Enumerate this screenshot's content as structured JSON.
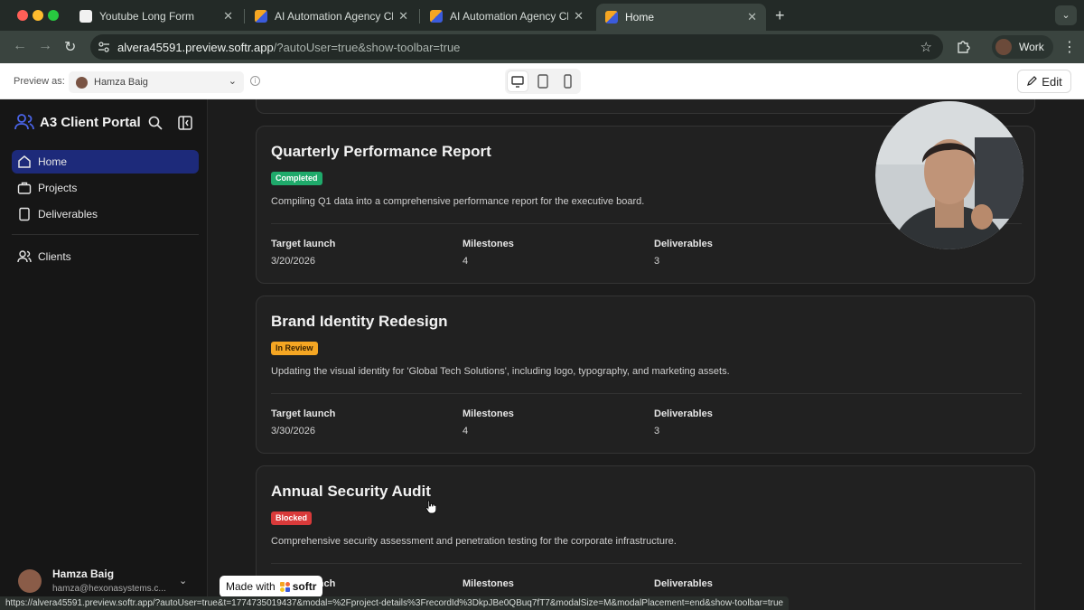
{
  "browser": {
    "tabs": [
      {
        "title": "Youtube Long Form",
        "active": false
      },
      {
        "title": "AI Automation Agency Client",
        "active": false
      },
      {
        "title": "AI Automation Agency Client",
        "active": false
      },
      {
        "title": "Home",
        "active": true
      }
    ],
    "url_host": "alvera45591.preview.softr.app",
    "url_path": "/?autoUser=true&show-toolbar=true",
    "profile_label": "Work",
    "status_url": "https://alvera45591.preview.softr.app/?autoUser=true&t=1774735019437&modal=%2Fproject-details%3FrecordId%3DkpJBe0QBuq7fT7&modalSize=M&modalPlacement=end&show-toolbar=true"
  },
  "toolbar": {
    "preview_label": "Preview as:",
    "preview_user": "Hamza Baig",
    "edit_label": "Edit"
  },
  "sidebar": {
    "app_name": "A3 Client Portal",
    "items": [
      {
        "label": "Home",
        "icon": "home-icon",
        "active": true
      },
      {
        "label": "Projects",
        "icon": "briefcase-icon",
        "active": false
      },
      {
        "label": "Deliverables",
        "icon": "document-icon",
        "active": false
      },
      {
        "label": "Clients",
        "icon": "users-icon",
        "active": false
      }
    ],
    "user": {
      "name": "Hamza Baig",
      "email": "hamza@hexonasystems.c..."
    }
  },
  "projects": [
    {
      "title": "Quarterly Performance Report",
      "status": "Completed",
      "description": "Compiling Q1 data into a comprehensive performance report for the executive board.",
      "target_launch_label": "Target launch",
      "target_launch": "3/20/2026",
      "milestones_label": "Milestones",
      "milestones": "4",
      "deliverables_label": "Deliverables",
      "deliverables": "3"
    },
    {
      "title": "Brand Identity Redesign",
      "status": "In Review",
      "description": "Updating the visual identity for 'Global Tech Solutions', including logo, typography, and marketing assets.",
      "target_launch_label": "Target launch",
      "target_launch": "3/30/2026",
      "milestones_label": "Milestones",
      "milestones": "4",
      "deliverables_label": "Deliverables",
      "deliverables": "3"
    },
    {
      "title": "Annual Security Audit",
      "status": "Blocked",
      "description": "Comprehensive security assessment and penetration testing for the corporate infrastructure.",
      "target_launch_label": "Target launch",
      "milestones_label": "Milestones",
      "deliverables_label": "Deliverables"
    }
  ],
  "badge": {
    "made_with": "Made with",
    "brand": "softr"
  },
  "colors": {
    "accent": "#1d2a7a",
    "completed": "#1faa6b",
    "in_review": "#f5a623",
    "blocked": "#d93a3a"
  }
}
